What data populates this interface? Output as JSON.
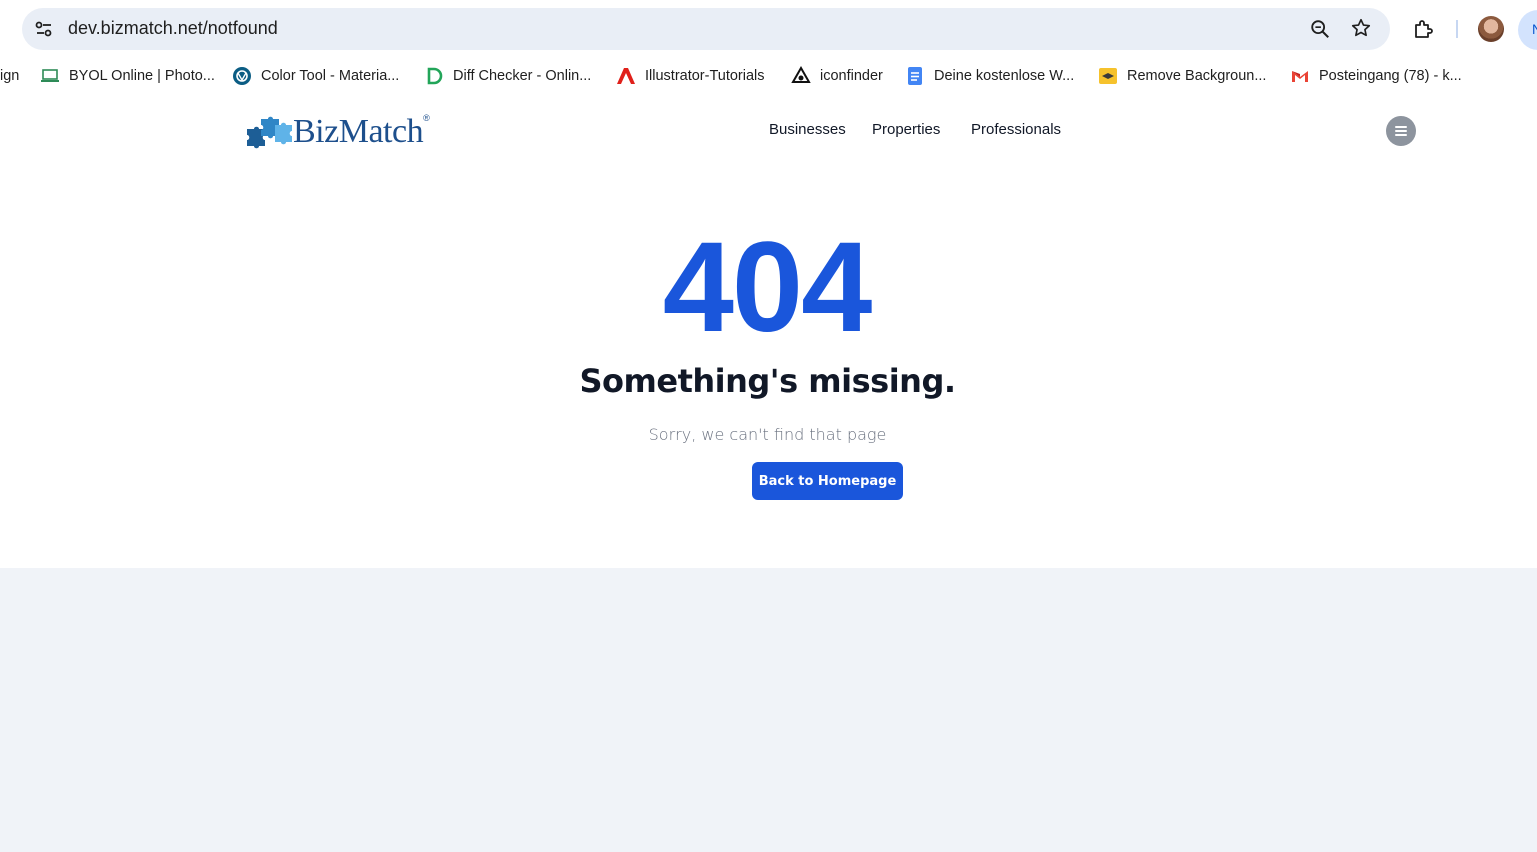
{
  "browser": {
    "url": "dev.bizmatch.net/notfound",
    "profile_initial": "N",
    "bookmarks": [
      {
        "label": "ign",
        "icon": "none"
      },
      {
        "label": "BYOL Online | Photo...",
        "icon": "laptop-icon"
      },
      {
        "label": "Color Tool - Materia...",
        "icon": "material-icon"
      },
      {
        "label": "Diff Checker - Onlin...",
        "icon": "diffchecker-icon"
      },
      {
        "label": "Illustrator-Tutorials",
        "icon": "adobe-icon"
      },
      {
        "label": "iconfinder",
        "icon": "iconfinder-icon"
      },
      {
        "label": "Deine kostenlose W...",
        "icon": "docs-icon"
      },
      {
        "label": "Remove Backgroun...",
        "icon": "removebg-icon"
      },
      {
        "label": "Posteingang (78) - k...",
        "icon": "gmail-icon"
      }
    ]
  },
  "header": {
    "logo_text": "BizMatch",
    "logo_mark": "®",
    "nav": [
      "Businesses",
      "Properties",
      "Professionals"
    ]
  },
  "main": {
    "code": "404",
    "headline": "Something's missing.",
    "message": "Sorry, we can't find that page",
    "button_label": "Back to Homepage"
  },
  "colors": {
    "accent": "#1a56db",
    "heading": "#111827",
    "muted": "#6b7280",
    "footer_bg": "#f0f3f8"
  }
}
